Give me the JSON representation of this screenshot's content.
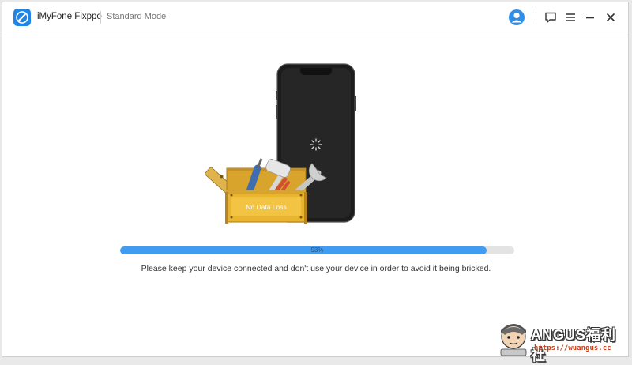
{
  "window": {
    "app_name": "iMyFone Fixppo",
    "mode": "Standard Mode"
  },
  "illustration": {
    "badge_text": "No Data Loss"
  },
  "progress": {
    "value": 0.93,
    "label": "93%"
  },
  "message": "Please keep your device connected and don't use your device in order to avoid it being bricked.",
  "watermark": {
    "title": "ANGUS福利社",
    "url": "https://wuangus.cc"
  },
  "colors": {
    "accent": "#3f9cf0",
    "logo": "#1f86e8",
    "box": "#e9b52f",
    "phone": "#1c1c1c"
  },
  "icons": [
    "app-logo-icon",
    "user-icon",
    "feedback-icon",
    "menu-icon",
    "minimize-icon",
    "close-icon",
    "spinner-icon"
  ]
}
